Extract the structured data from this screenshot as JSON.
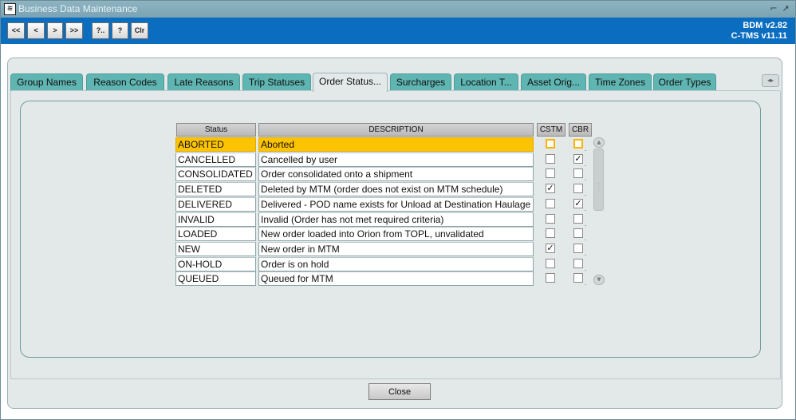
{
  "window": {
    "title": "Business Data Maintenance",
    "app_icon": "bdm-icon",
    "minimize_glyph": "⌐",
    "maximize_glyph": "↗"
  },
  "toolbar": {
    "buttons": [
      "<<",
      "<",
      ">",
      ">>",
      "?..",
      "?",
      "Clr"
    ],
    "version_line1": "BDM v2.82",
    "version_line2": "C-TMS v11.11"
  },
  "tabs": [
    "Group Names",
    "Reason Codes",
    "Late Reasons",
    "Trip Statuses",
    "Order Status...",
    "Surcharges",
    "Location T...",
    "Asset Orig...",
    "Time Zones",
    "Order Types"
  ],
  "active_tab_index": 4,
  "table": {
    "headers": {
      "status": "Status",
      "description": "DESCRIPTION",
      "cstm": "CSTM",
      "cbr": "CBR"
    },
    "rows": [
      {
        "status": "ABORTED",
        "description": "Aborted",
        "cstm": false,
        "cbr": false,
        "selected": true
      },
      {
        "status": "CANCELLED",
        "description": "Cancelled by user",
        "cstm": false,
        "cbr": true,
        "selected": false
      },
      {
        "status": "CONSOLIDATED",
        "description": "Order consolidated onto a shipment",
        "cstm": false,
        "cbr": false,
        "selected": false
      },
      {
        "status": "DELETED",
        "description": "Deleted by MTM  (order does not exist on MTM schedule)",
        "cstm": true,
        "cbr": false,
        "selected": false
      },
      {
        "status": "DELIVERED",
        "description": "Delivered - POD name exists for Unload at Destination Haulage",
        "cstm": false,
        "cbr": true,
        "selected": false
      },
      {
        "status": "INVALID",
        "description": "Invalid (Order has not met required criteria)",
        "cstm": false,
        "cbr": false,
        "selected": false
      },
      {
        "status": "LOADED",
        "description": "New order loaded into Orion from TOPL, unvalidated",
        "cstm": false,
        "cbr": false,
        "selected": false
      },
      {
        "status": "NEW",
        "description": "New order in MTM",
        "cstm": true,
        "cbr": false,
        "selected": false
      },
      {
        "status": "ON-HOLD",
        "description": "Order is on hold",
        "cstm": false,
        "cbr": false,
        "selected": false
      },
      {
        "status": "QUEUED",
        "description": "Queued for MTM",
        "cstm": false,
        "cbr": false,
        "selected": false
      }
    ],
    "check_glyph": "✓",
    "row_marker": "."
  },
  "footer": {
    "close_label": "Close"
  },
  "colors": {
    "toolbar": "#0b6dbf",
    "tab": "#5fb5b2",
    "selected_row": "#fcc300"
  }
}
